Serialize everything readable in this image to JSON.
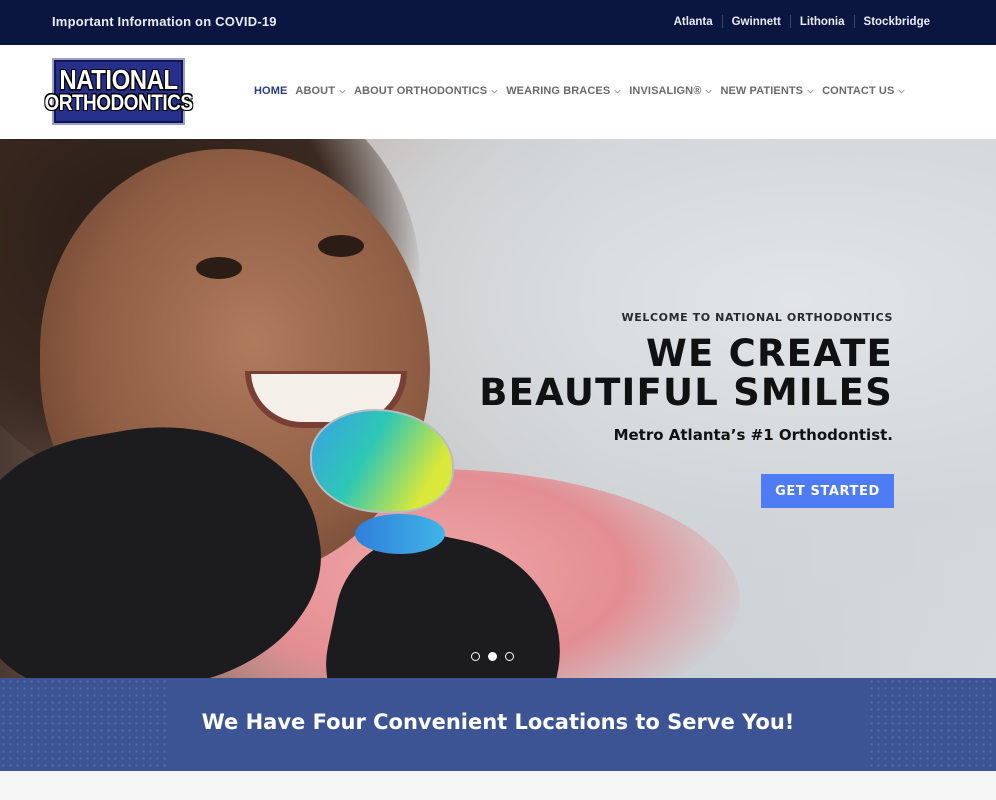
{
  "topbar": {
    "covid_link": "Important Information on COVID-19",
    "locations": [
      "Atlanta",
      "Gwinnett",
      "Lithonia",
      "Stockbridge"
    ]
  },
  "logo": {
    "line1": "NATIONAL",
    "line2": "ORTHODONTICS"
  },
  "nav": {
    "home": "HOME",
    "about": "ABOUT",
    "about_ortho": "ABOUT ORTHODONTICS",
    "braces": "WEARING BRACES",
    "invisalign": "INVISALIGN®",
    "new_patients": "NEW PATIENTS",
    "contact": "CONTACT US"
  },
  "hero": {
    "welcome": "WELCOME TO NATIONAL ORTHODONTICS",
    "headline_line1": "WE CREATE",
    "headline_line2": "BEAUTIFUL SMILES",
    "subheadline": "Metro Atlanta’s #1 Orthodontist.",
    "cta_label": "GET STARTED",
    "slides_total": 3,
    "active_slide": 2
  },
  "locations_banner": {
    "title": "We Have Four Convenient Locations to Serve You!"
  },
  "colors": {
    "topbar_bg": "#0b1640",
    "nav_active": "#2a3d7d",
    "cta_bg": "#4f7cf4",
    "locations_bg": "#3c5494"
  }
}
